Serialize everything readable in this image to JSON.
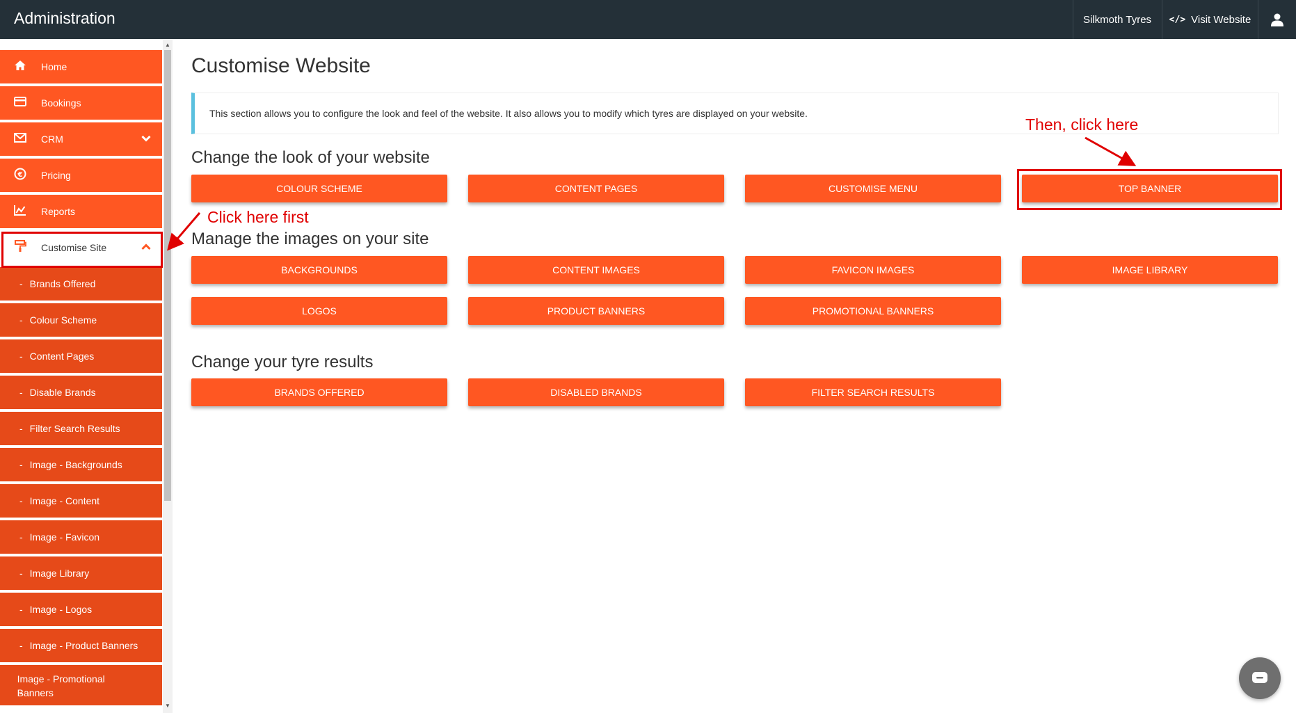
{
  "topbar": {
    "app_title": "Administration",
    "company": "Silkmoth Tyres",
    "visit_icon": "</>",
    "visit_label": "Visit Website",
    "user_icon": "user-icon"
  },
  "sidebar": {
    "items": [
      {
        "label": "Home",
        "icon": "home-icon"
      },
      {
        "label": "Bookings",
        "icon": "card-icon"
      },
      {
        "label": "CRM",
        "icon": "envelope-icon",
        "caret": "chevron-down"
      },
      {
        "label": "Pricing",
        "icon": "euro-icon"
      },
      {
        "label": "Reports",
        "icon": "chart-icon"
      },
      {
        "label": "Customise Site",
        "icon": "paint-roller-icon",
        "caret": "chevron-up",
        "active": true
      }
    ],
    "sub_items": [
      "Brands Offered",
      "Colour Scheme",
      "Content Pages",
      "Disable Brands",
      "Filter Search Results",
      "Image - Backgrounds",
      "Image - Content",
      "Image - Favicon",
      "Image Library",
      "Image - Logos",
      "Image - Product Banners",
      "Image - Promotional Banners"
    ]
  },
  "main": {
    "title": "Customise Website",
    "info": "This section allows you to configure the look and feel of the website. It also allows you to modify which tyres are displayed on your website.",
    "sections": [
      {
        "title": "Change the look of your website",
        "buttons": [
          "COLOUR SCHEME",
          "CONTENT PAGES",
          "CUSTOMISE MENU",
          "TOP BANNER"
        ]
      },
      {
        "title": "Manage the images on your site",
        "buttons": [
          "BACKGROUNDS",
          "CONTENT IMAGES",
          "FAVICON IMAGES",
          "IMAGE LIBRARY",
          "LOGOS",
          "PRODUCT BANNERS",
          "PROMOTIONAL BANNERS"
        ]
      },
      {
        "title": "Change your tyre results",
        "buttons": [
          "BRANDS OFFERED",
          "DISABLED BRANDS",
          "FILTER SEARCH RESULTS"
        ]
      }
    ]
  },
  "annotations": {
    "first": "Click here first",
    "then": "Then, click here"
  },
  "colors": {
    "brand": "#ff5722",
    "sub_menu": "#e64a19",
    "topbar": "#243038",
    "annotation": "#e00000",
    "info_accent": "#5bc0de"
  },
  "chat": {
    "icon": "chat-icon"
  }
}
